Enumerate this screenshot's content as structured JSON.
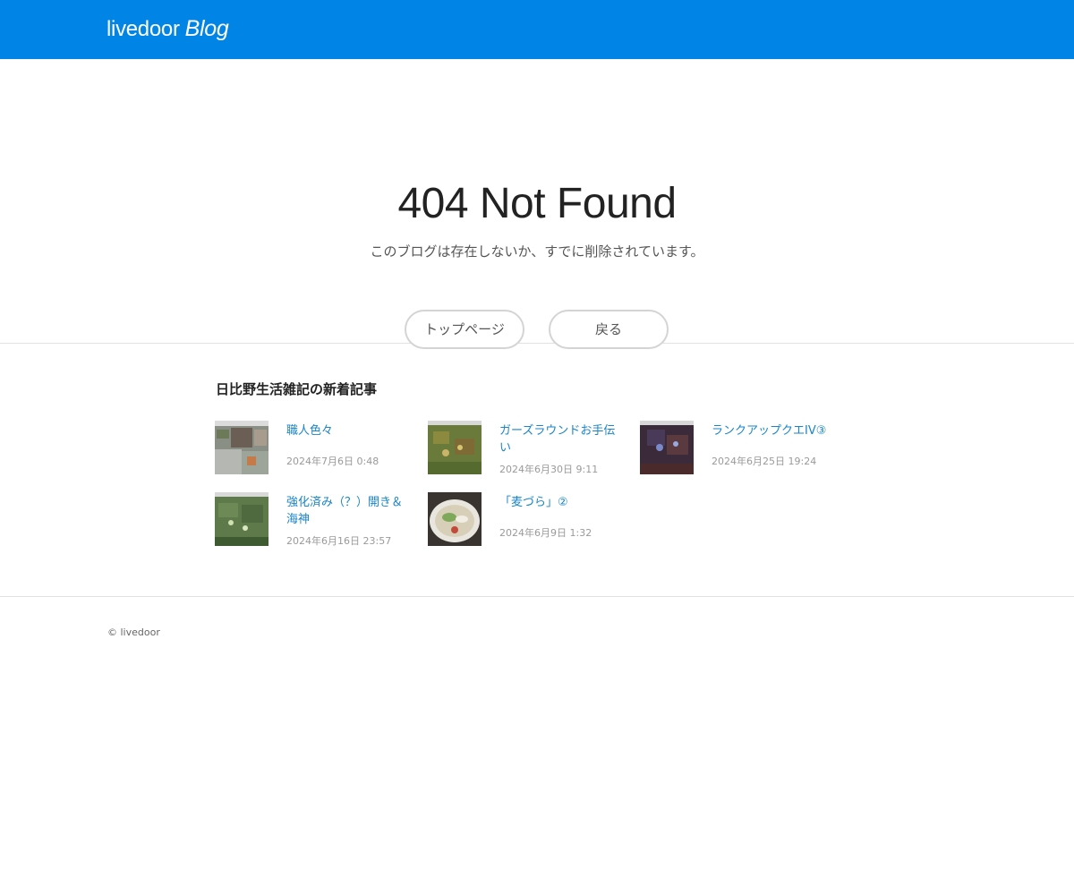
{
  "header": {
    "logo_part1": "livedoor",
    "logo_part2": "Blog"
  },
  "error": {
    "title": "404 Not Found",
    "message": "このブログは存在しないか、すでに削除されています。",
    "top_button": "トップページ",
    "back_button": "戻る"
  },
  "articles": {
    "heading": "日比野生活雑記の新着記事",
    "items": [
      {
        "title": "職人色々",
        "date": "2024年7月6日 0:48"
      },
      {
        "title": "ガーズラウンドお手伝い",
        "date": "2024年6月30日 9:11"
      },
      {
        "title": "ランクアップクエIV③",
        "date": "2024年6月25日 19:24"
      },
      {
        "title": "強化済み（？）開き＆海神",
        "date": "2024年6月16日 23:57"
      },
      {
        "title": "「麦づら」②",
        "date": "2024年6月9日 1:32"
      }
    ]
  },
  "footer": {
    "copyright": "© livedoor"
  },
  "colors": {
    "brand_blue": "#0084e6",
    "link_blue": "#1a85c8",
    "divider": "#e2e2e2"
  }
}
